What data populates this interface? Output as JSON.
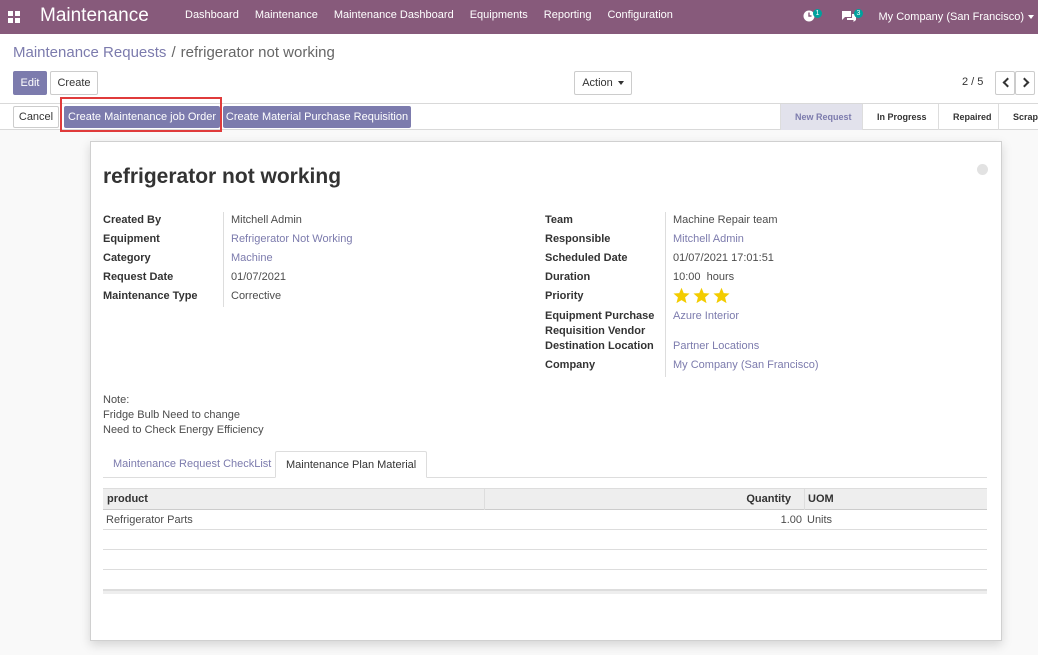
{
  "navbar": {
    "brand": "Maintenance",
    "menu": [
      "Dashboard",
      "Maintenance",
      "Maintenance Dashboard",
      "Equipments",
      "Reporting",
      "Configuration"
    ],
    "activity_count": "1",
    "messages_count": "3",
    "company": "My Company (San Francisco)"
  },
  "breadcrumb": {
    "parent": "Maintenance Requests",
    "separator": "/",
    "current": "refrigerator not working"
  },
  "toolbar": {
    "edit_label": "Edit",
    "create_label": "Create",
    "action_label": "Action",
    "pager": "2 / 5"
  },
  "statusbar": {
    "cancel_label": "Cancel",
    "job_order_label": "Create Maintenance job Order",
    "purchase_label": "Create Material Purchase Requisition",
    "stages": [
      "New Request",
      "In Progress",
      "Repaired",
      "Scrap"
    ],
    "active_stage": "New Request"
  },
  "colors": {
    "brand": "#875a7b",
    "primary": "#7c7bad",
    "highlight": "#e03b3b",
    "star": "#f3cc00"
  },
  "record": {
    "title": "refrigerator not working",
    "left": [
      {
        "label": "Created By",
        "value": "Mitchell Admin",
        "link": false
      },
      {
        "label": "Equipment",
        "value": "Refrigerator Not Working",
        "link": true
      },
      {
        "label": "Category",
        "value": "Machine",
        "link": true
      },
      {
        "label": "Request Date",
        "value": "01/07/2021",
        "link": false
      },
      {
        "label": "Maintenance Type",
        "value": "Corrective",
        "link": false
      }
    ],
    "right": {
      "team_label": "Team",
      "team": "Machine Repair team",
      "responsible_label": "Responsible",
      "responsible": "Mitchell Admin",
      "scheduled_label": "Scheduled Date",
      "scheduled": "01/07/2021 17:01:51",
      "duration_label": "Duration",
      "duration": "10:00  hours",
      "priority_label": "Priority",
      "priority_stars": 3,
      "vendor_label_1": "Equipment Purchase",
      "vendor_label_2": "Requisition Vendor",
      "vendor": "Azure Interior",
      "destination_label": "Destination Location",
      "destination": "Partner Locations",
      "company_label": "Company",
      "company": "My Company (San Francisco)"
    },
    "note": [
      "Note:",
      "Fridge Bulb Need to change",
      "Need to Check Energy Efficiency"
    ]
  },
  "tabs": [
    "Maintenance Request CheckList",
    "Maintenance Plan Material"
  ],
  "active_tab": "Maintenance Plan Material",
  "material_table": {
    "columns": [
      "product",
      "Quantity",
      "UOM"
    ],
    "rows": [
      {
        "product": "Refrigerator Parts",
        "quantity": "1.00",
        "uom": "Units"
      }
    ]
  }
}
